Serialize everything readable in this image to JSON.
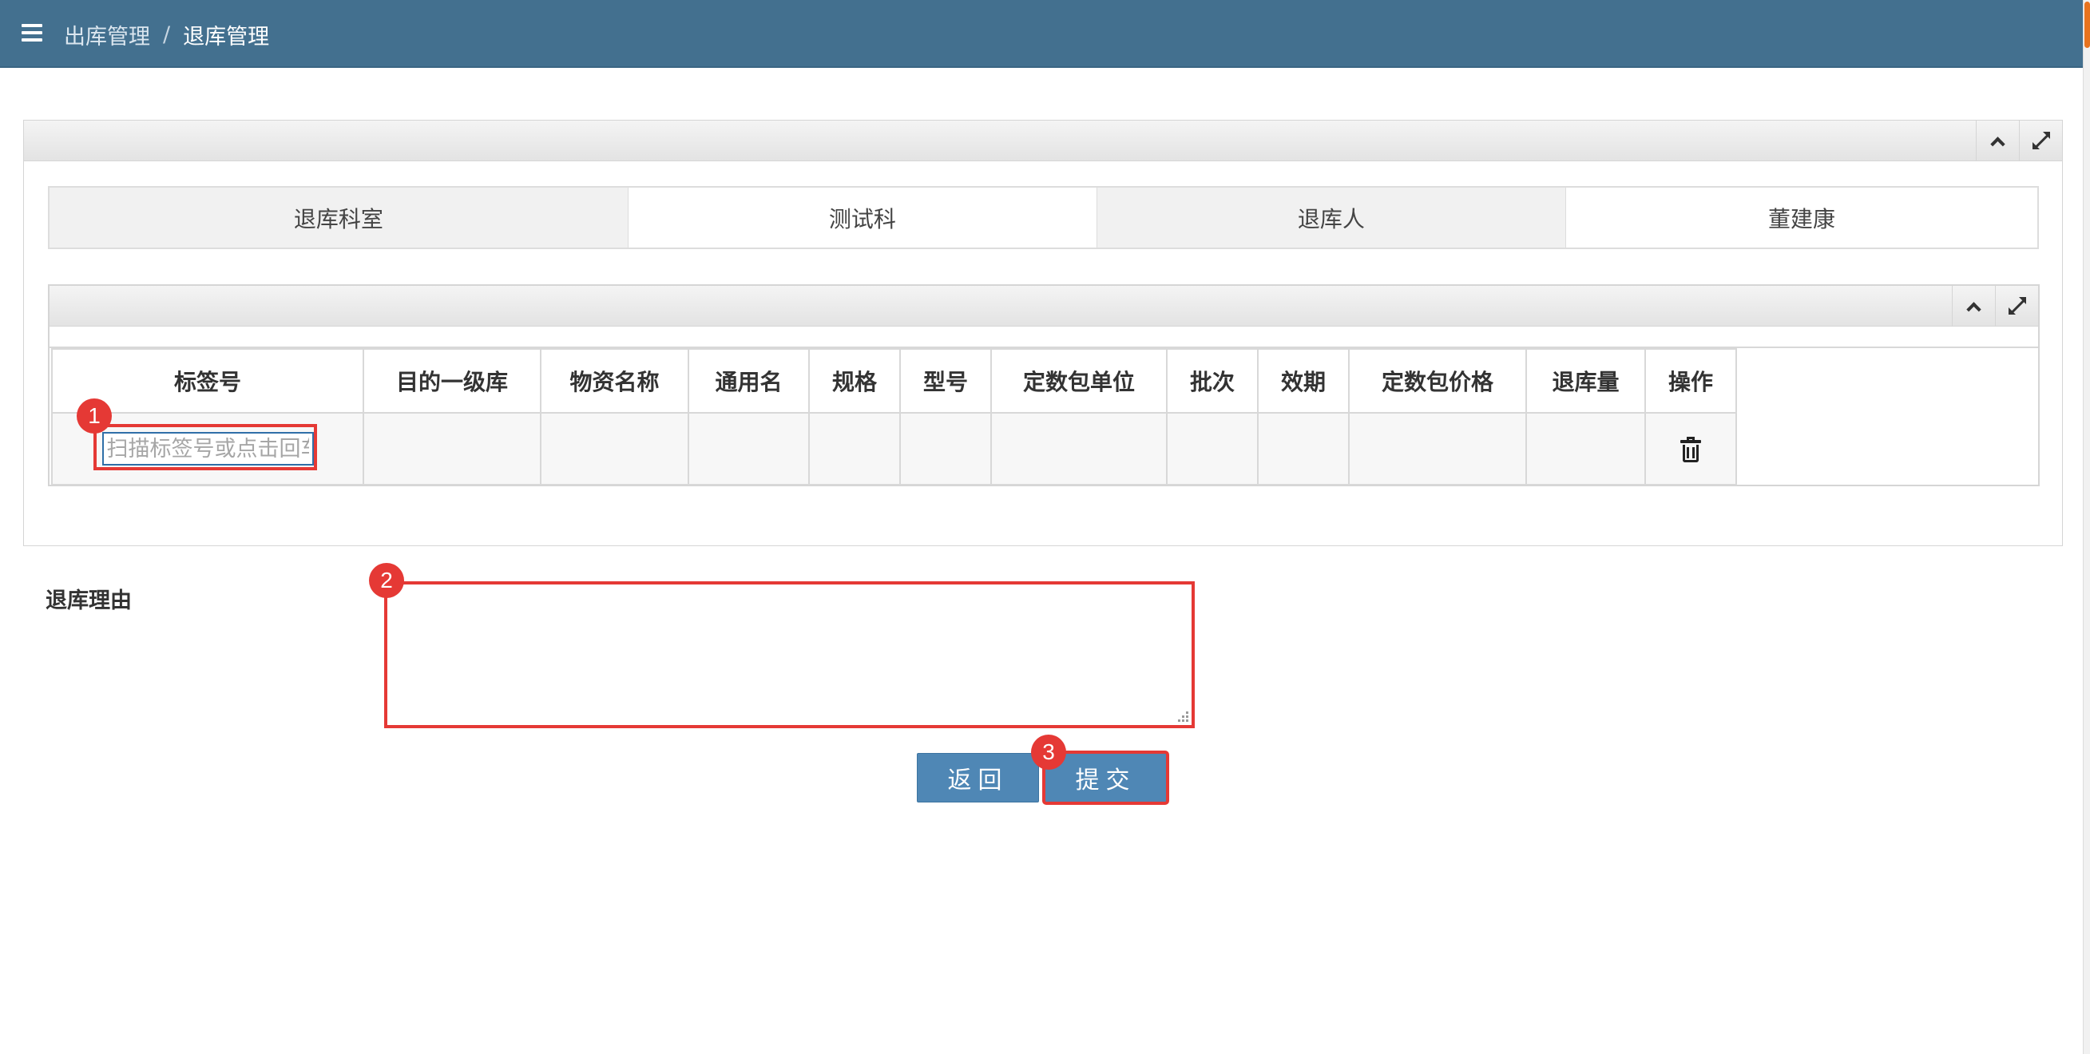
{
  "breadcrumb": {
    "parent": "出库管理",
    "separator": "/",
    "current": "退库管理"
  },
  "info": {
    "dept_label": "退库科室",
    "dept_value": "测试科",
    "person_label": "退库人",
    "person_value": "董建康"
  },
  "table": {
    "headers": [
      "标签号",
      "目的一级库",
      "物资名称",
      "通用名",
      "规格",
      "型号",
      "定数包单位",
      "批次",
      "效期",
      "定数包价格",
      "退库量",
      "操作"
    ],
    "tag_placeholder": "扫描标签号或点击回车"
  },
  "reason": {
    "label": "退库理由",
    "value": ""
  },
  "buttons": {
    "back": "返回",
    "submit": "提交"
  },
  "annotations": {
    "step1": "1",
    "step2": "2",
    "step3": "3"
  },
  "colors": {
    "topbar": "#43708f",
    "button": "#4f87b5",
    "highlight": "#e53935"
  },
  "icons": {
    "menu": "menu-icon",
    "collapse": "chevron-up-icon",
    "fullscreen": "expand-icon",
    "delete": "trash-icon"
  }
}
